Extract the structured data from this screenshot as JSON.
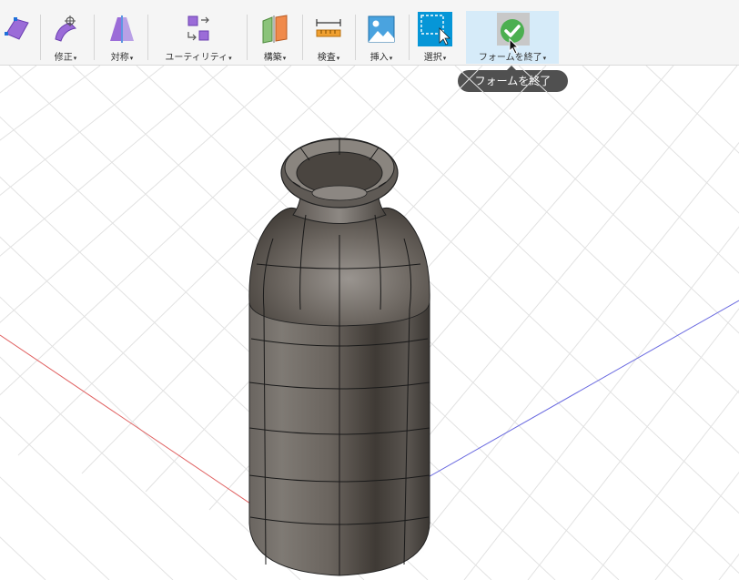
{
  "toolbar": {
    "tools": [
      {
        "id": "create",
        "label": "",
        "icon": "create-form-icon"
      },
      {
        "id": "modify",
        "label": "修正",
        "icon": "modify-icon"
      },
      {
        "id": "symmetry",
        "label": "対称",
        "icon": "symmetry-icon"
      },
      {
        "id": "utility",
        "label": "ユーティリティ",
        "icon": "utility-icon"
      },
      {
        "id": "construct",
        "label": "構築",
        "icon": "construct-icon"
      },
      {
        "id": "inspect",
        "label": "検査",
        "icon": "inspect-icon"
      },
      {
        "id": "insert",
        "label": "挿入",
        "icon": "insert-icon"
      },
      {
        "id": "select",
        "label": "選択",
        "icon": "select-icon"
      },
      {
        "id": "finish_form",
        "label": "フォームを終了",
        "icon": "finish-form-check-icon"
      }
    ],
    "caret": "▾"
  },
  "tooltip": {
    "text": "フォームを終了"
  },
  "colors": {
    "accent_blue": "#0696d7",
    "check_green": "#4caf50",
    "active_bg": "#d6ebf9",
    "x_axis": "#e06060",
    "y_axis": "#6a6ae0"
  }
}
